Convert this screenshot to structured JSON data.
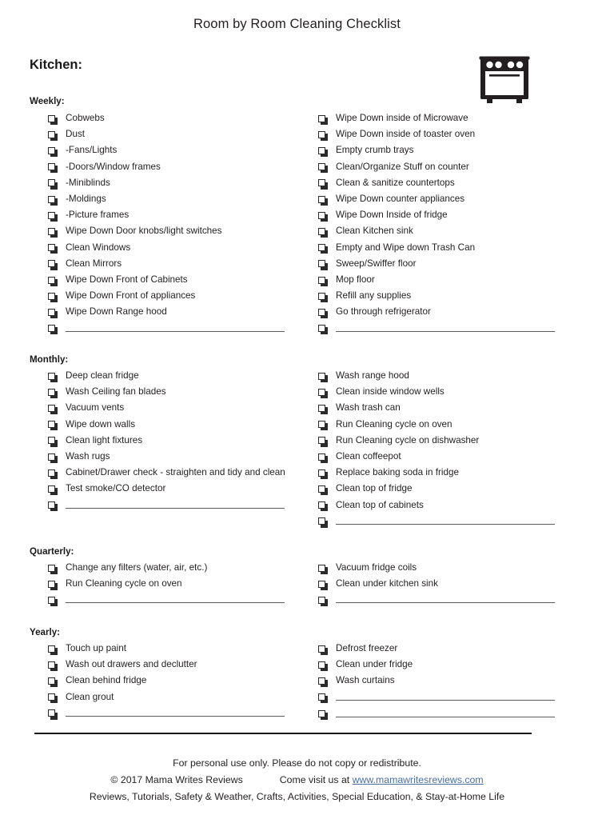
{
  "document": {
    "title": "Room by Room Cleaning Checklist",
    "room_heading": "Kitchen:",
    "icon": "oven-icon"
  },
  "sections": [
    {
      "label": "Weekly:",
      "left_items": [
        "Cobwebs",
        "Dust",
        "-Fans/Lights",
        "-Doors/Window frames",
        "-Miniblinds",
        "-Moldings",
        "-Picture frames",
        "Wipe Down Door knobs/light switches",
        "Clean Windows",
        "Clean Mirrors",
        "Wipe Down Front of Cabinets",
        "Wipe Down Front of appliances",
        "Wipe Down Range hood",
        ""
      ],
      "right_items": [
        "Wipe Down inside of Microwave",
        "Wipe Down inside of toaster oven",
        "Empty crumb trays",
        "Clean/Organize Stuff on counter",
        "Clean & sanitize countertops",
        "Wipe Down counter appliances",
        "Wipe Down Inside of fridge",
        "Clean Kitchen sink",
        "Empty and Wipe down Trash Can",
        "Sweep/Swiffer floor",
        "Mop floor",
        "Refill any supplies",
        "Go through refrigerator",
        ""
      ]
    },
    {
      "label": "Monthly:",
      "left_items": [
        "Deep clean fridge",
        "Wash Ceiling fan blades",
        "Vacuum vents",
        "Wipe down walls",
        "Clean light fixtures",
        "Wash rugs",
        "Cabinet/Drawer check - straighten and tidy and clean",
        "Test smoke/CO detector",
        ""
      ],
      "right_items": [
        "Wash range hood",
        "Clean inside window wells",
        "Wash trash can",
        "Run Cleaning cycle on oven",
        "Run Cleaning cycle on dishwasher",
        "Clean coffeepot",
        "Replace baking soda in fridge",
        "Clean top of fridge",
        "Clean top of cabinets",
        ""
      ]
    },
    {
      "label": "Quarterly:",
      "left_items": [
        "Change any filters (water, air, etc.)",
        "Run Cleaning cycle on oven",
        ""
      ],
      "right_items": [
        "Vacuum fridge coils",
        "Clean under kitchen sink",
        ""
      ]
    },
    {
      "label": "Yearly:",
      "left_items": [
        "Touch up paint",
        "Wash out drawers and declutter",
        "Clean behind fridge",
        "Clean grout",
        ""
      ],
      "right_items": [
        "Defrost freezer",
        "Clean under fridge",
        "Wash curtains",
        "",
        ""
      ]
    }
  ],
  "footer": {
    "line1": "For personal use only. Please do not copy or redistribute.",
    "copyright": "© 2017 Mama Writes Reviews",
    "visit_prefix": "Come visit us at ",
    "link_text": "www.mamawritesreviews.com",
    "link_color": "#4a6fa5",
    "line3": "Reviews, Tutorials, Safety & Weather, Crafts, Activities, Special Education, & Stay-at-Home Life"
  }
}
